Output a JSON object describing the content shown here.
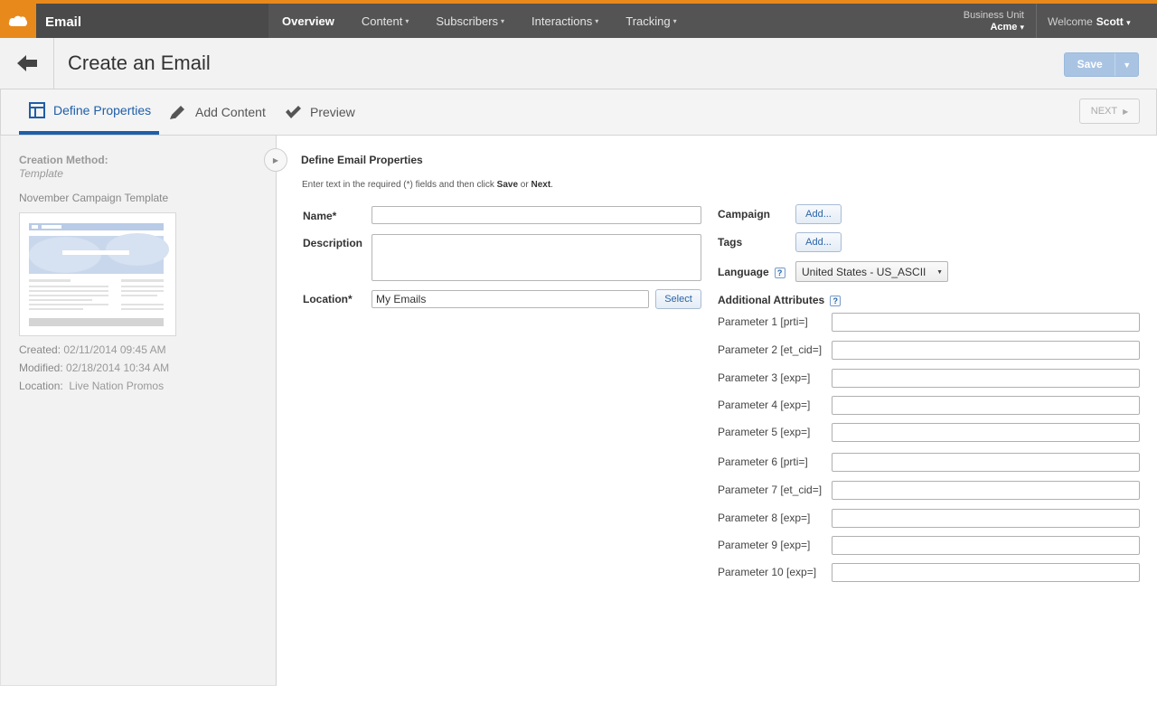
{
  "app": {
    "name": "Email"
  },
  "nav": {
    "items": [
      {
        "label": "Overview",
        "chevron": false
      },
      {
        "label": "Content",
        "chevron": true
      },
      {
        "label": "Subscribers",
        "chevron": true
      },
      {
        "label": "Interactions",
        "chevron": true
      },
      {
        "label": "Tracking",
        "chevron": true
      }
    ],
    "business_unit_label": "Business Unit",
    "business_unit_value": "Acme",
    "welcome_label": "Welcome",
    "user_name": "Scott"
  },
  "header": {
    "title": "Create an Email",
    "save_label": "Save"
  },
  "steps": {
    "items": [
      "Define Properties",
      "Add Content",
      "Preview"
    ],
    "next_label": "NEXT"
  },
  "sidebar": {
    "creation_method_label": "Creation Method:",
    "creation_method_value": "Template",
    "template_name": "November Campaign Template",
    "created_label": "Created:",
    "created_value": "02/11/2014 09:45 AM",
    "modified_label": "Modified:",
    "modified_value": "02/18/2014 10:34 AM",
    "location_label": "Location:",
    "location_value": "Live Nation Promos"
  },
  "form": {
    "section_title": "Define Email Properties",
    "instr_before": "Enter text in the required (*) fields and then click ",
    "instr_save": "Save",
    "instr_or": " or ",
    "instr_next": "Next",
    "instr_end": ".",
    "name_label": "Name*",
    "name_value": "",
    "description_label": "Description",
    "location_label": "Location*",
    "location_value": "My Emails",
    "select_label": "Select",
    "campaign_label": "Campaign",
    "tags_label": "Tags",
    "add_label": "Add...",
    "language_label": "Language",
    "language_value": "United States - US_ASCII",
    "help_glyph": "?",
    "additional_label": "Additional Attributes"
  },
  "parameters": [
    "Parameter 1 [prti=]",
    "Parameter 2 [et_cid=]",
    "Parameter 3 [exp=]",
    "Parameter 4 [exp=]",
    "Parameter 5 [exp=]",
    "Parameter 6 [prti=]",
    "Parameter 7 [et_cid=]",
    "Parameter 8 [exp=]",
    "Parameter 9 [exp=]",
    "Parameter 10  [exp=]"
  ],
  "colors": {
    "brand_orange": "#e8891c",
    "nav_bg": "#545454",
    "active_blue": "#1f5ea8"
  },
  "icons": {
    "logo": "cloud-icon",
    "back": "arrow-left-icon",
    "define": "layout-icon",
    "content": "pencil-icon",
    "preview": "check-icon"
  }
}
